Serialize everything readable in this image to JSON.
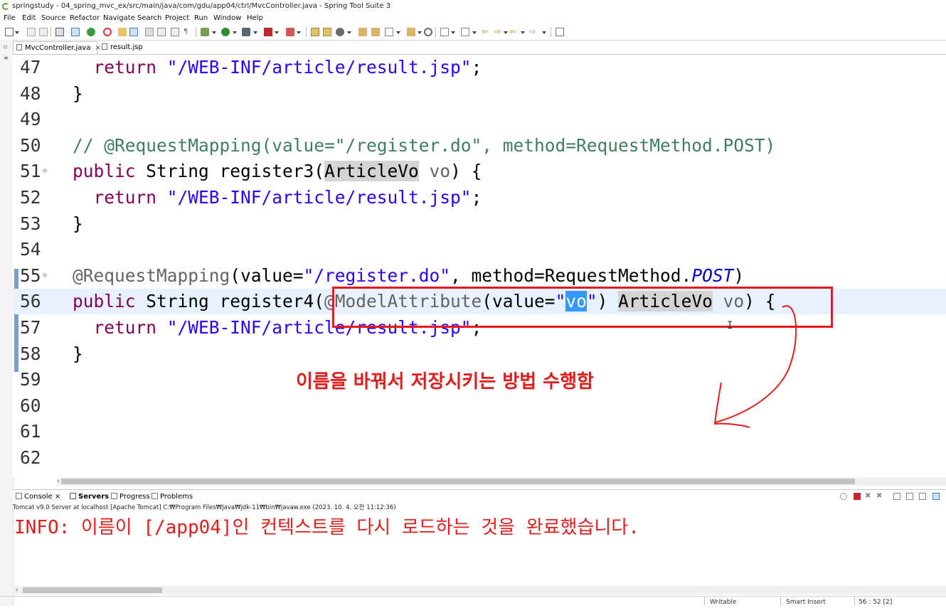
{
  "window": {
    "title": "springstudy - 04_spring_mvc_ex/src/main/java/com/gdu/app04/ctrl/MvcController.java - Spring Tool Suite 3"
  },
  "menu": [
    "File",
    "Edit",
    "Source",
    "Refactor",
    "Navigate",
    "Search",
    "Project",
    "Run",
    "Window",
    "Help"
  ],
  "tabs": [
    {
      "label": "MvcController.java",
      "active": true,
      "close": "×"
    },
    {
      "label": "result.jsp",
      "active": false
    }
  ],
  "editor": {
    "lines": [
      {
        "num": "47",
        "fold": "",
        "segments": [
          {
            "t": "  ",
            "c": ""
          },
          {
            "t": "return",
            "c": "kw"
          },
          {
            "t": " ",
            "c": ""
          },
          {
            "t": "\"/WEB-INF/article/result.jsp\"",
            "c": "str"
          },
          {
            "t": ";",
            "c": ""
          }
        ]
      },
      {
        "num": "48",
        "fold": "",
        "segments": [
          {
            "t": "}",
            "c": ""
          }
        ]
      },
      {
        "num": "49",
        "fold": "",
        "segments": []
      },
      {
        "num": "50",
        "fold": "",
        "segments": [
          {
            "t": "// @RequestMapping(value=\"/register.do\", method=RequestMethod.POST)",
            "c": "cmt"
          }
        ]
      },
      {
        "num": "51",
        "fold": "⊖",
        "segments": [
          {
            "t": "public",
            "c": "kw"
          },
          {
            "t": " String register3(",
            "c": ""
          },
          {
            "t": "ArticleVo",
            "c": "occ"
          },
          {
            "t": " ",
            "c": ""
          },
          {
            "t": "vo",
            "c": "ann"
          },
          {
            "t": ") {",
            "c": ""
          }
        ]
      },
      {
        "num": "52",
        "fold": "",
        "segments": [
          {
            "t": "  ",
            "c": ""
          },
          {
            "t": "return",
            "c": "kw"
          },
          {
            "t": " ",
            "c": ""
          },
          {
            "t": "\"/WEB-INF/article/result.jsp\"",
            "c": "str"
          },
          {
            "t": ";",
            "c": ""
          }
        ]
      },
      {
        "num": "53",
        "fold": "",
        "segments": [
          {
            "t": "}",
            "c": ""
          }
        ]
      },
      {
        "num": "54",
        "fold": "",
        "segments": []
      },
      {
        "num": "55",
        "fold": "⊖",
        "segments": [
          {
            "t": "@RequestMapping",
            "c": "ann"
          },
          {
            "t": "(value=",
            "c": ""
          },
          {
            "t": "\"/register.do\"",
            "c": "str"
          },
          {
            "t": ", method=RequestMethod.",
            "c": ""
          },
          {
            "t": "POST",
            "c": "ital"
          },
          {
            "t": ")",
            "c": ""
          }
        ]
      },
      {
        "num": "56",
        "fold": "",
        "hl": true,
        "segments": [
          {
            "t": "public",
            "c": "kw"
          },
          {
            "t": " String register4(",
            "c": ""
          },
          {
            "t": "@ModelAttribute",
            "c": "ann"
          },
          {
            "t": "(value=",
            "c": ""
          },
          {
            "t": "\"",
            "c": "str"
          },
          {
            "t": "vo",
            "c": "selword"
          },
          {
            "t": "\"",
            "c": "str"
          },
          {
            "t": ") ",
            "c": ""
          },
          {
            "t": "ArticleVo",
            "c": "occ"
          },
          {
            "t": " ",
            "c": ""
          },
          {
            "t": "vo",
            "c": "ann"
          },
          {
            "t": ") {",
            "c": ""
          }
        ]
      },
      {
        "num": "57",
        "fold": "",
        "segments": [
          {
            "t": "  ",
            "c": ""
          },
          {
            "t": "return",
            "c": "kw"
          },
          {
            "t": " ",
            "c": ""
          },
          {
            "t": "\"/WEB-INF/article/result.jsp\"",
            "c": "str"
          },
          {
            "t": ";",
            "c": ""
          }
        ]
      },
      {
        "num": "58",
        "fold": "",
        "segments": [
          {
            "t": "}",
            "c": ""
          }
        ]
      },
      {
        "num": "59",
        "fold": "",
        "segments": []
      },
      {
        "num": "60",
        "fold": "",
        "segments": []
      },
      {
        "num": "61",
        "fold": "",
        "segments": []
      },
      {
        "num": "62",
        "fold": "",
        "segments": []
      }
    ]
  },
  "annotation": {
    "text": "이름을 바꿔서 저장시키는 방법 수행함",
    "color": "#e31b1b"
  },
  "console_tabs": [
    {
      "label": "Console",
      "close": "×"
    },
    {
      "label": "Servers",
      "bold": true
    },
    {
      "label": "Progress"
    },
    {
      "label": "Problems"
    }
  ],
  "console": {
    "description": "Tomcat v9.0 Server at localhost [Apache Tomcat] C:₩Program Files₩Java₩jdk-11₩bin₩javaw.exe  (2023. 10. 4. 오전 11:12:36)",
    "output": "INFO: 이름이 [/app04]인 컨텍스트를 다시 로드하는 것을 완료했습니다."
  },
  "status": {
    "writable": "Writable",
    "insert_mode": "Smart Insert",
    "position": "56 : 52 [2]"
  }
}
